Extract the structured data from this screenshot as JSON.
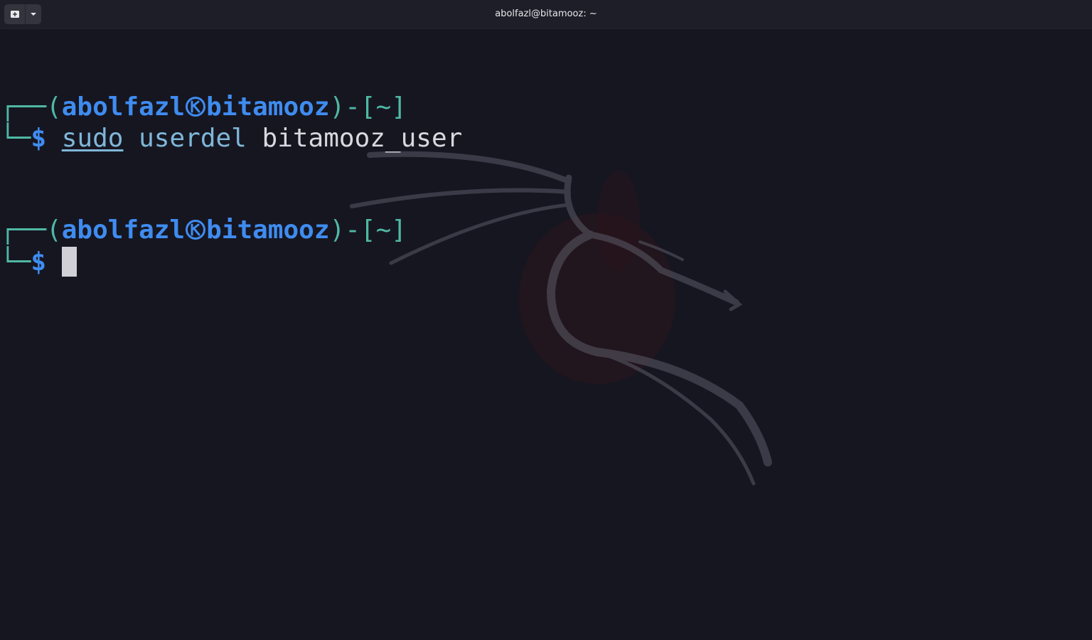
{
  "window": {
    "title": "abolfazl@bitamooz: ~"
  },
  "icons": {
    "new_tab": "new-tab-icon",
    "menu": "chevron-down-icon",
    "prompt_separator": "kali-skull-icon",
    "watermark": "kali-dragon-icon"
  },
  "colors": {
    "background": "#161621",
    "prompt_frame": "#4fb9a4",
    "prompt_user_host": "#3f8cf0",
    "command": "#7fb7d9",
    "argument": "#d8d8de"
  },
  "terminal": {
    "blocks": [
      {
        "frame_top": "┌──",
        "open_paren": "(",
        "user": "abolfazl",
        "host": "bitamooz",
        "close_paren": ")",
        "dash": "-",
        "dir_open": "[",
        "dir": "~",
        "dir_close": "]",
        "frame_bottom": "└─",
        "prompt": "$",
        "cmd_sudo": "sudo",
        "cmd_name": "userdel",
        "cmd_arg": "bitamooz_user"
      },
      {
        "frame_top": "┌──",
        "open_paren": "(",
        "user": "abolfazl",
        "host": "bitamooz",
        "close_paren": ")",
        "dash": "-",
        "dir_open": "[",
        "dir": "~",
        "dir_close": "]",
        "frame_bottom": "└─",
        "prompt": "$"
      }
    ]
  }
}
